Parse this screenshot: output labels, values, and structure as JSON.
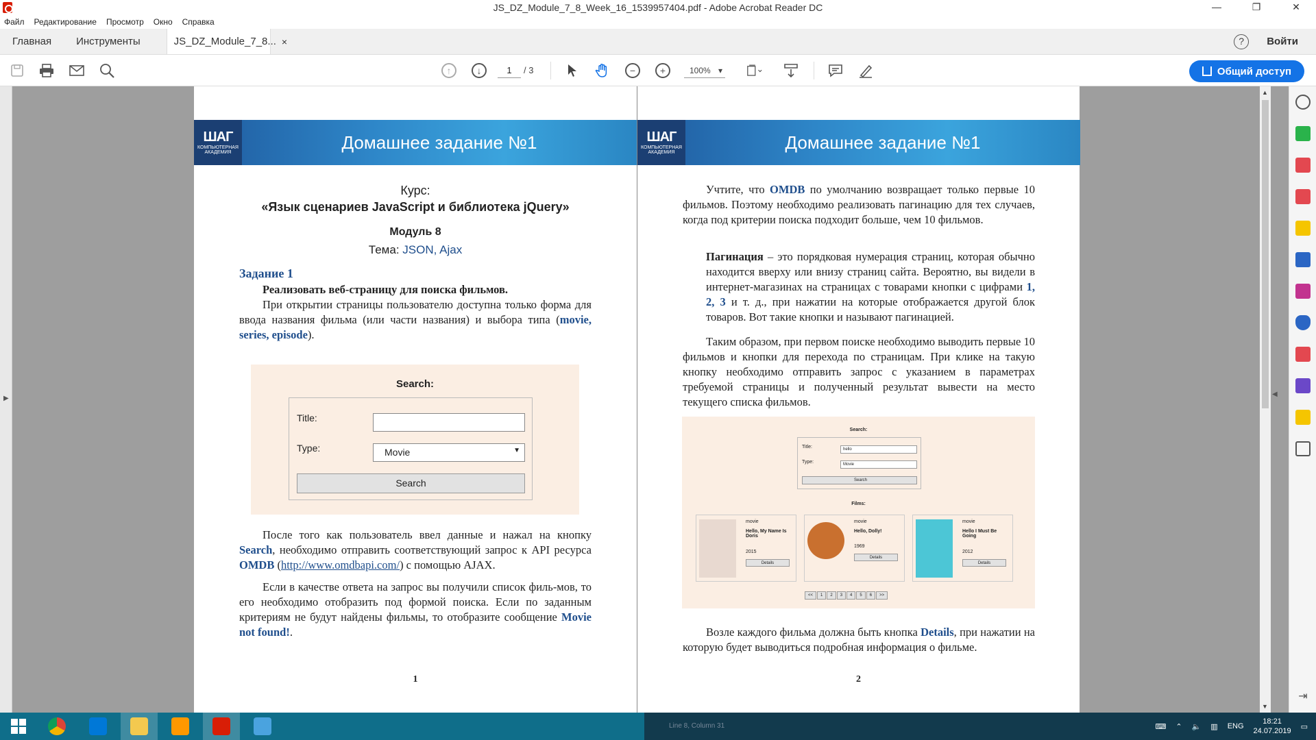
{
  "window": {
    "title": "JS_DZ_Module_7_8_Week_16_1539957404.pdf - Adobe Acrobat Reader DC",
    "minimize": "—",
    "maximize": "❐",
    "close": "✕"
  },
  "menu": [
    "Файл",
    "Редактирование",
    "Просмотр",
    "Окно",
    "Справка"
  ],
  "tabs": {
    "home": "Главная",
    "tools": "Инструменты",
    "doc": "JS_DZ_Module_7_8...",
    "close": "×",
    "help": "?",
    "signin": "Войти"
  },
  "toolbar": {
    "page_current": "1",
    "page_total": "/ 3",
    "zoom": "100%",
    "share_label": "Общий доступ",
    "icons": [
      "save-icon",
      "print-icon",
      "mail-icon",
      "search-icon",
      "prev-page-icon",
      "next-page-icon",
      "select-tool-icon",
      "hand-tool-icon",
      "zoom-out-icon",
      "zoom-in-icon",
      "fit-page-icon",
      "scroll-mode-icon",
      "comment-icon",
      "sign-icon"
    ]
  },
  "page1": {
    "banner_title": "Домашнее задание №1",
    "logo": "ШАГ",
    "logo_sub": "КОМПЬЮТЕРНАЯ АКАДЕМИЯ",
    "course_label": "Курс:",
    "course_name": "«Язык сценариев JavaScript и библиотека jQuery»",
    "module": "Модуль 8",
    "topic_label": "Тема: ",
    "topic": "JSON, Ajax",
    "task_heading": "Задание 1",
    "task_lead": "Реализовать веб-страницу для поиска фильмов.",
    "para1_a": "При открытии страницы пользователю доступна только форма для ввода названия фильма (или части названия) и выбора типа (",
    "para1_b": "movie, series, episode",
    "para1_c": ").",
    "form": {
      "heading": "Search:",
      "title_label": "Title:",
      "type_label": "Type:",
      "type_value": "Movie",
      "button": "Search"
    },
    "para2_a": "После того как пользователь ввел данные и нажал на кнопку ",
    "para2_b": "Search",
    "para2_c": ", необходимо отправить соответствующий запрос к API ресурса ",
    "para2_d": "OMDB",
    "para2_e": " (",
    "para2_link": "http://www.omdbapi.com/",
    "para2_f": ") с помощью AJAX.",
    "para3_a": "Если в качестве ответа на запрос вы получили список филь-мов, то его необходимо отобразить под формой поиска. Если по заданным критериям не будут найдены фильмы, то отобразите сообщение ",
    "para3_b": "Movie not found!",
    "para3_c": ".",
    "page_number": "1"
  },
  "page2": {
    "banner_title": "Домашнее задание №1",
    "para1_a": "Учтите, что ",
    "para1_b": "OMDB",
    "para1_c": " по умолчанию возвращает только первые 10 фильмов. Поэтому необходимо реализовать пагинацию для тех случаев, когда под критерии поиска подходит больше, чем 10 фильмов.",
    "para2_a": "Пагинация",
    "para2_b": " – это порядковая нумерация страниц, которая обычно находится вверху или внизу страниц сайта. Вероятно, вы видели в интернет-магазинах на страницах с товарами кнопки с цифрами ",
    "para2_c": "1, 2, 3",
    "para2_d": " и т. д., при нажатии на которые отображается другой блок товаров. Вот такие  кнопки и называют пагинацией.",
    "para3": "Таким образом, при первом поиске необходимо выводить первые 10 фильмов и кнопки для перехода по страницам. При клике на такую кнопку необходимо отправить запрос с указанием в параметрах требуемой страницы и полученный результат вывести на место текущего списка фильмов.",
    "mini": {
      "heading": "Search:",
      "title_label": "Title:",
      "title_value": "hello",
      "type_label": "Type:",
      "type_value": "Movie",
      "button": "Search",
      "films_heading": "Films:",
      "cards": [
        {
          "type": "movie",
          "title": "Hello, My Name Is Doris",
          "year": "2015",
          "button": "Details",
          "poster_color": "#e8d9d0"
        },
        {
          "type": "movie",
          "title": "Hello, Dolly!",
          "year": "1969",
          "button": "Details",
          "poster_color": "#c9702f"
        },
        {
          "type": "movie",
          "title": "Hello I Must Be Going",
          "year": "2012",
          "button": "Details",
          "poster_color": "#4cc6d6"
        }
      ],
      "pager": [
        "<<",
        "1",
        "2",
        "3",
        "4",
        "5",
        "6",
        ">>"
      ]
    },
    "para4_a": "Возле каждого фильма должна быть кнопка ",
    "para4_b": "Details",
    "para4_c": ", при нажатии на которую будет выводиться подробная информация о фильме.",
    "page_number": "2"
  },
  "right_panel_icons": [
    "zoom-panel-icon",
    "export-pdf-icon",
    "create-pdf-icon",
    "organize-icon",
    "comment-panel-icon",
    "combine-icon",
    "fill-sign-icon",
    "protect-icon",
    "pdf-icon",
    "sign-panel-icon",
    "send-icon",
    "more-tools-icon"
  ],
  "taskbar": {
    "apps": [
      "windows-start",
      "chrome",
      "vscode",
      "explorer",
      "sublime",
      "acrobat",
      "store"
    ],
    "editor_status": "Line 8, Column 31",
    "lang": "ENG",
    "time": "18:21",
    "date": "24.07.2019"
  },
  "colors": {
    "accent": "#1473e6",
    "doc_bg": "#9e9e9e",
    "taskbar": "#0f6e8a",
    "banner": "#2e86c8",
    "form_bg": "#fbeee3",
    "link_blue": "#1f4e8c"
  }
}
